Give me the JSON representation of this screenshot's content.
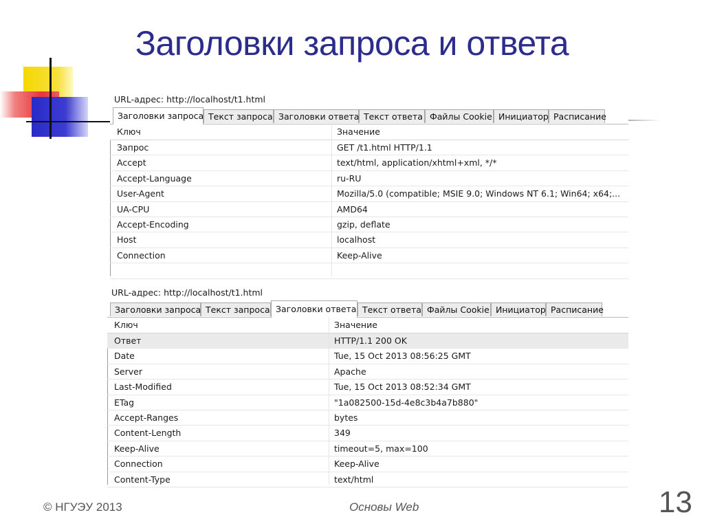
{
  "slide": {
    "title": "Заголовки запроса и ответа",
    "footer_left": "© НГУЭУ 2013",
    "footer_center": "Основы Web",
    "page_number": "13"
  },
  "request_panel": {
    "url_label": "URL-адрес: http://localhost/t1.html",
    "tabs": [
      "Заголовки запроса",
      "Текст запроса",
      "Заголовки ответа",
      "Текст ответа",
      "Файлы Cookie",
      "Инициатор",
      "Расписание"
    ],
    "active_tab": "Заголовки запроса",
    "columns": [
      "Ключ",
      "Значение"
    ],
    "rows": [
      [
        "Запрос",
        "GET /t1.html HTTP/1.1"
      ],
      [
        "Accept",
        "text/html, application/xhtml+xml, */*"
      ],
      [
        "Accept-Language",
        "ru-RU"
      ],
      [
        "User-Agent",
        "Mozilla/5.0 (compatible; MSIE 9.0; Windows NT 6.1; Win64; x64;..."
      ],
      [
        "UA-CPU",
        "AMD64"
      ],
      [
        "Accept-Encoding",
        "gzip, deflate"
      ],
      [
        "Host",
        "localhost"
      ],
      [
        "Connection",
        "Keep-Alive"
      ]
    ]
  },
  "response_panel": {
    "url_label": "URL-адрес: http://localhost/t1.html",
    "tabs": [
      "Заголовки запроса",
      "Текст запроса",
      "Заголовки ответа",
      "Текст ответа",
      "Файлы Cookie",
      "Инициатор",
      "Расписание"
    ],
    "active_tab": "Заголовки ответа",
    "columns": [
      "Ключ",
      "Значение"
    ],
    "rows": [
      [
        "Ответ",
        "HTTP/1.1 200 OK"
      ],
      [
        "Date",
        "Tue, 15 Oct 2013 08:56:25 GMT"
      ],
      [
        "Server",
        "Apache"
      ],
      [
        "Last-Modified",
        "Tue, 15 Oct 2013 08:52:34 GMT"
      ],
      [
        "ETag",
        "\"1a082500-15d-4e8c3b4a7b880\""
      ],
      [
        "Accept-Ranges",
        "bytes"
      ],
      [
        "Content-Length",
        "349"
      ],
      [
        "Keep-Alive",
        "timeout=5, max=100"
      ],
      [
        "Connection",
        "Keep-Alive"
      ],
      [
        "Content-Type",
        "text/html"
      ]
    ]
  },
  "colors": {
    "title": "#2b2c8c",
    "deco_yellow": "#f5d800",
    "deco_red": "#e8353a",
    "deco_blue": "#2a2ac8"
  }
}
